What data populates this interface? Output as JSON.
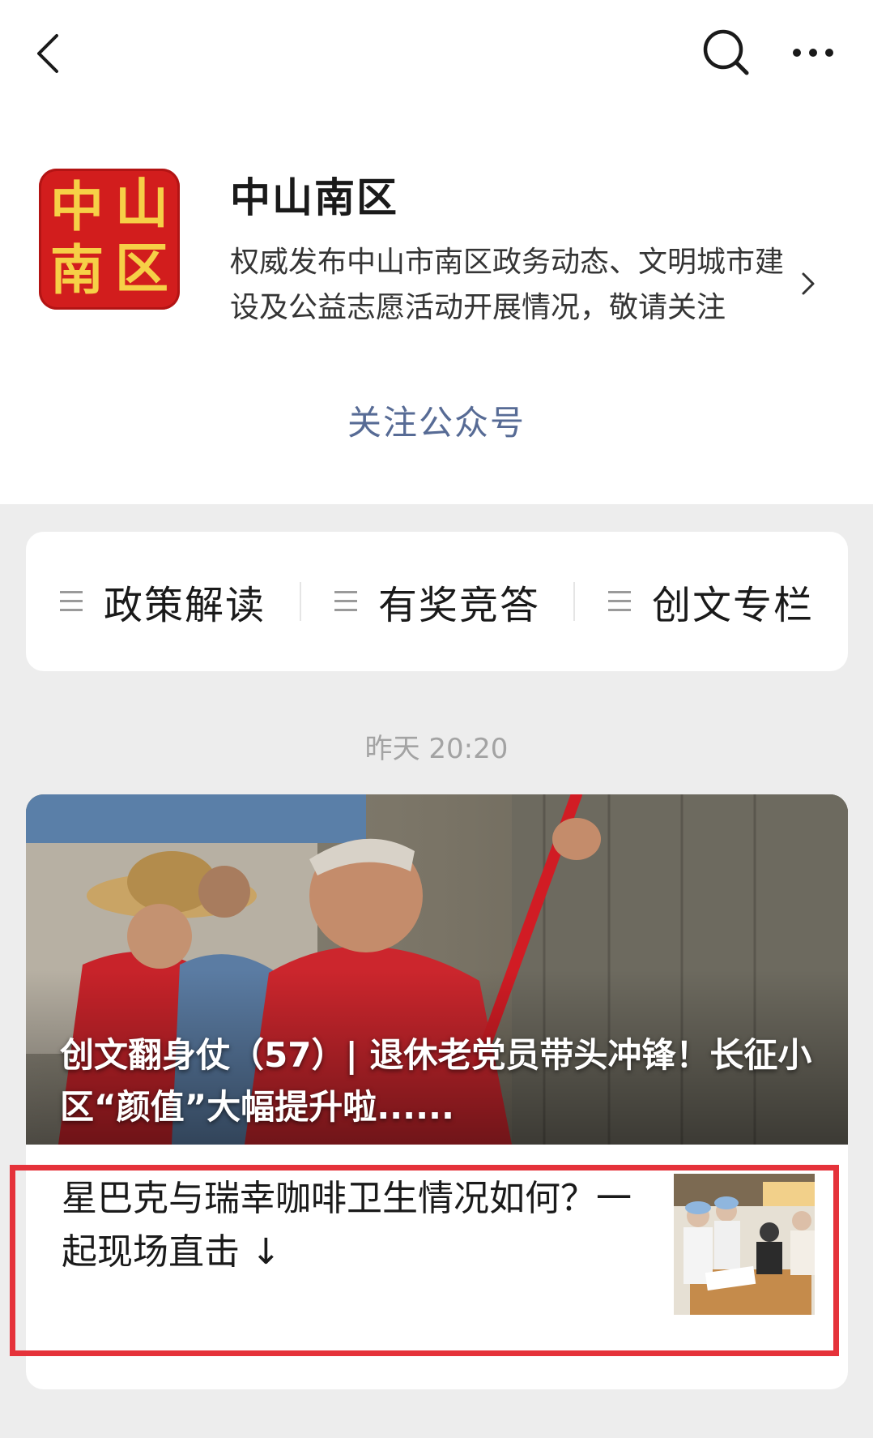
{
  "account": {
    "name": "中山南区",
    "description": "权威发布中山市南区政务动态、文明城市建设及公益志愿活动开展情况，敬请关注",
    "logo_chars": [
      "中",
      "山",
      "南",
      "区"
    ],
    "follow_label": "关注公众号"
  },
  "menu": {
    "items": [
      {
        "label": "政策解读"
      },
      {
        "label": "有奖竞答"
      },
      {
        "label": "创文专栏"
      }
    ]
  },
  "feed": {
    "timestamp": "昨天 20:20",
    "main_article": {
      "title": "创文翻身仗（57）| 退休老党员带头冲锋！长征小区“颜值”大幅提升啦......"
    },
    "sub_article": {
      "title": "星巴克与瑞幸咖啡卫生情况如何？一起现场直击 ↓"
    }
  },
  "colors": {
    "link": "#576b95",
    "logo_red": "#d21d1d",
    "logo_gold": "#f6d047",
    "highlight_red": "#e5323a",
    "background": "#ededed"
  },
  "icons": {
    "back": "chevron-left-icon",
    "search": "search-icon",
    "more": "more-dots-icon",
    "menu": "menu-lines-icon",
    "desc": "chevron-right-icon"
  }
}
